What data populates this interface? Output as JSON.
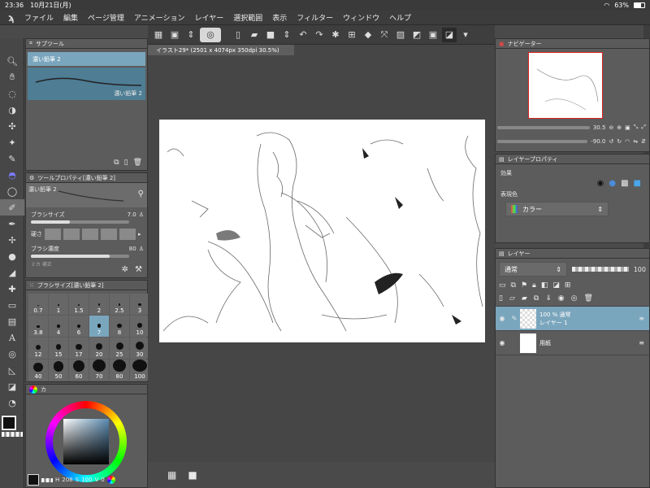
{
  "status": {
    "time": "23:36",
    "date": "10月21日(月)",
    "wifi_icon": "wifi-icon",
    "battery": "63%"
  },
  "menu": {
    "items": [
      "ファイル",
      "編集",
      "ページ管理",
      "アニメーション",
      "レイヤー",
      "選択範囲",
      "表示",
      "フィルター",
      "ウィンドウ",
      "ヘルプ"
    ]
  },
  "document": {
    "tab_title": "イラスト29* (2501 x 4074px 350dpi 30.5%)"
  },
  "subtool": {
    "title": "サブツール",
    "selected_label": "濃い鉛筆 2",
    "preview_label": "濃い鉛筆 2"
  },
  "tool_property": {
    "title": "ツールプロパティ[濃い鉛筆 2]",
    "tool_name": "濃い鉛筆 2",
    "brush_size_label": "ブラシサイズ",
    "brush_size_value": "7.0",
    "hardness_label": "硬さ",
    "density_label": "ブラシ濃度",
    "density_value": "80",
    "cut_label": "ミカ 補正"
  },
  "brush_size_panel": {
    "title": "ブラシサイズ[濃い鉛筆 2]",
    "sizes": [
      "0.7",
      "1",
      "1.5",
      "2",
      "2.5",
      "3",
      "3.8",
      "4",
      "6",
      "7",
      "8",
      "10",
      "12",
      "15",
      "17",
      "20",
      "25",
      "30",
      "40",
      "50",
      "60",
      "70",
      "80",
      "100"
    ],
    "selected": "7"
  },
  "color_panel": {
    "tab": "カ",
    "h_value": "208",
    "s_value": "100",
    "v_value": "0",
    "accent": "#5b8bb0"
  },
  "navigator": {
    "title": "ナビゲーター",
    "zoom": "30.5",
    "rotation": "-90.0"
  },
  "layer_property": {
    "title": "レイヤープロパティ",
    "effect_label": "効果",
    "expression_label": "表現色",
    "expression_value": "カラー"
  },
  "layers": {
    "title": "レイヤー",
    "blend_mode": "通常",
    "opacity": "100",
    "rows": [
      {
        "meta": "100 % 通常",
        "name": "レイヤー 1"
      },
      {
        "meta": "",
        "name": "用紙"
      }
    ]
  },
  "colors": {
    "panel_bg": "#5c5c5c",
    "selection": "#7aa6bd",
    "canvas_bg": "#464646"
  }
}
